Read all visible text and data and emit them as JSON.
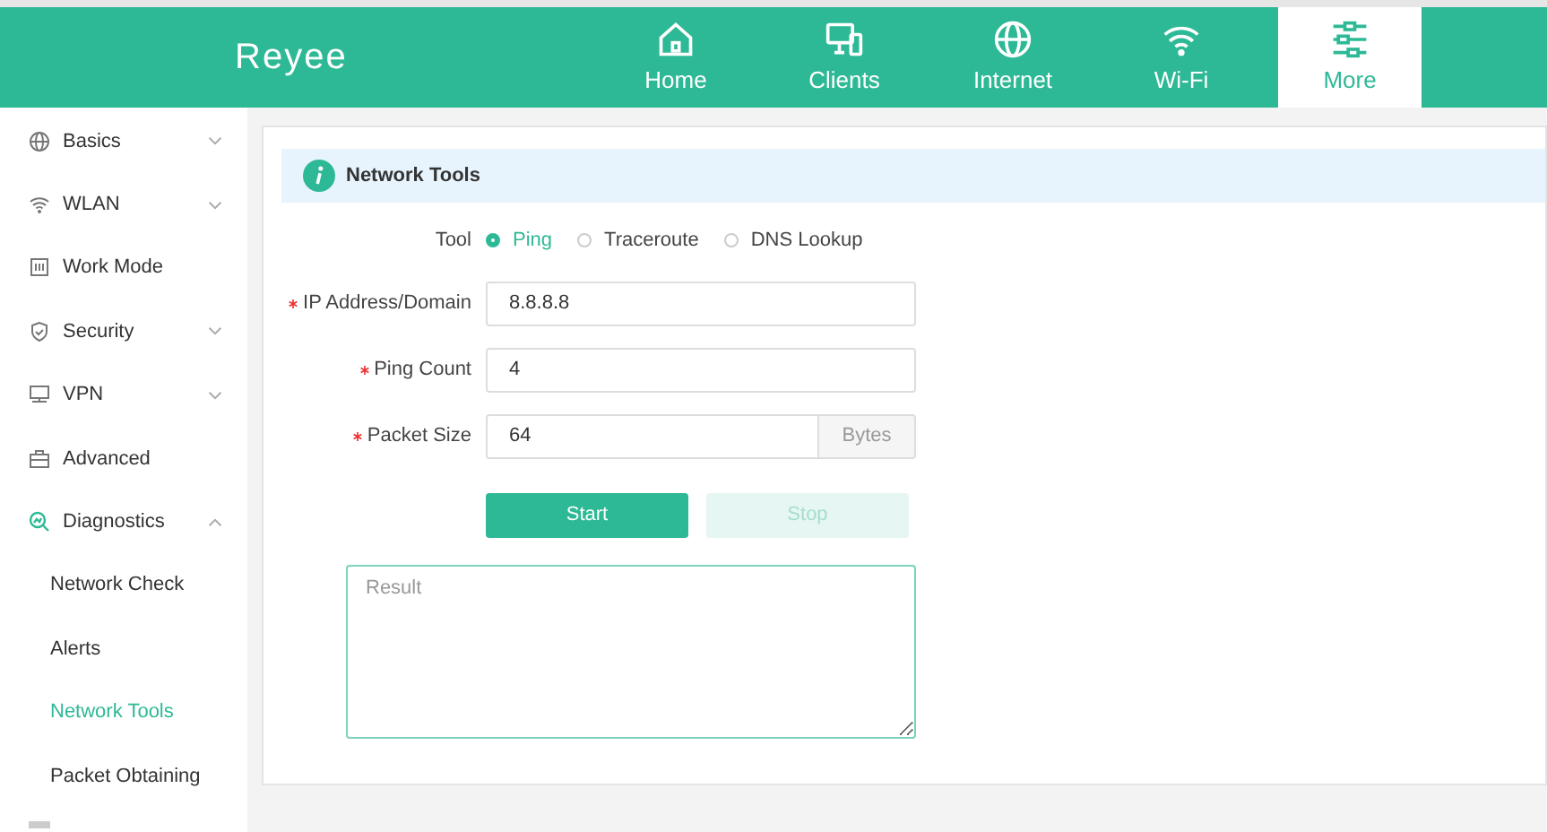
{
  "header": {
    "logo": "Reyee",
    "nav": [
      {
        "label": "Home",
        "selected": false
      },
      {
        "label": "Clients",
        "selected": false
      },
      {
        "label": "Internet",
        "selected": false
      },
      {
        "label": "Wi-Fi",
        "selected": false
      },
      {
        "label": "More",
        "selected": true
      }
    ]
  },
  "sidebar": {
    "items": [
      {
        "label": "Basics",
        "expanded": false,
        "has_children": true
      },
      {
        "label": "WLAN",
        "expanded": false,
        "has_children": true
      },
      {
        "label": "Work Mode",
        "expanded": false,
        "has_children": false
      },
      {
        "label": "Security",
        "expanded": false,
        "has_children": true
      },
      {
        "label": "VPN",
        "expanded": false,
        "has_children": true
      },
      {
        "label": "Advanced",
        "expanded": false,
        "has_children": false
      },
      {
        "label": "Diagnostics",
        "expanded": true,
        "has_children": true,
        "children": [
          {
            "label": "Network Check",
            "selected": false
          },
          {
            "label": "Alerts",
            "selected": false
          },
          {
            "label": "Network Tools",
            "selected": true
          },
          {
            "label": "Packet Obtaining",
            "selected": false
          }
        ]
      }
    ]
  },
  "panel": {
    "title": "Network Tools",
    "tool": {
      "label": "Tool",
      "options": [
        {
          "label": "Ping",
          "selected": true
        },
        {
          "label": "Traceroute",
          "selected": false
        },
        {
          "label": "DNS Lookup",
          "selected": false
        }
      ]
    },
    "fields": [
      {
        "label": "IP Address/Domain",
        "required": true,
        "value": "8.8.8.8"
      },
      {
        "label": "Ping Count",
        "required": true,
        "value": "4"
      },
      {
        "label": "Packet Size",
        "required": true,
        "value": "64",
        "suffix": "Bytes"
      }
    ],
    "buttons": [
      {
        "label": "Start",
        "disabled": false
      },
      {
        "label": "Stop",
        "disabled": true
      }
    ],
    "result": {
      "placeholder": "Result"
    }
  }
}
